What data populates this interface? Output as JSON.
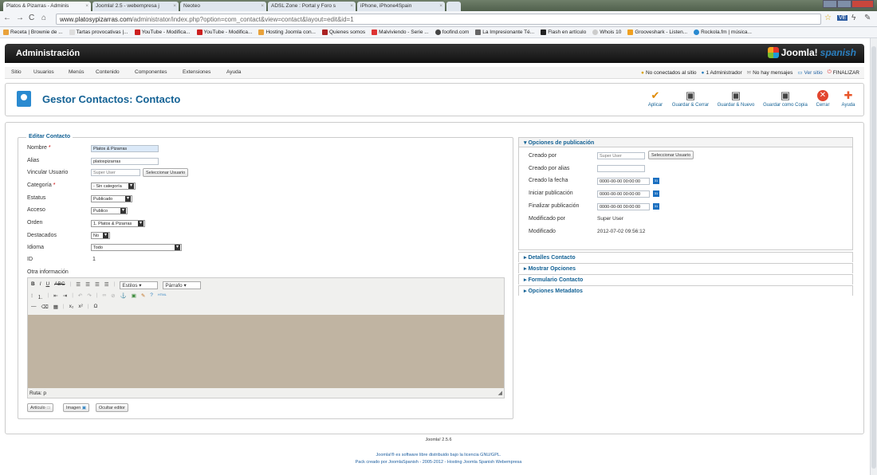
{
  "browser": {
    "tabs": [
      {
        "label": "Platos & Pizarras - Adminis",
        "active": true
      },
      {
        "label": "Joomla! 2.5 - webempresa j"
      },
      {
        "label": "Neoteo"
      },
      {
        "label": "ADSL Zone : Portal y Foro s"
      },
      {
        "label": "iPhone, iPhone4Spain"
      }
    ],
    "url_host": "www.platosypizarras.com",
    "url_path": "/administrator/index.php?option=com_contact&view=contact&layout=edit&id=1",
    "bookmarks": [
      "Receta | Brownie de ...",
      "Tartas provocativas |...",
      "YouTube - Modifica...",
      "YouTube - Modifica...",
      "Hosting Joomla con...",
      "Quienes somos",
      "Malviviendo - Serie ...",
      "foofind.com",
      "La Impresionante Té...",
      "Flash en artículo",
      "Whois 10",
      "Grooveshark - Listen...",
      "Rockola.fm | música..."
    ]
  },
  "admin": {
    "title": "Administración",
    "logo_word": "Joomla!",
    "logo_spanish": "spanish"
  },
  "menu": [
    "Sitio",
    "Usuarios",
    "Menús",
    "Contenido",
    "Componentes",
    "Extensiones",
    "Ayuda"
  ],
  "status": {
    "visitors": "No conectados al sitio",
    "admins": "1 Administrador",
    "messages": "No hay mensajes",
    "view_site": "Ver sitio",
    "logout": "FINALIZAR"
  },
  "page": {
    "title": "Gestor Contactos: Contacto"
  },
  "toolbar": {
    "apply": "Aplicar",
    "save_close": "Guardar & Cerrar",
    "save_new": "Guardar & Nuevo",
    "save_copy": "Guardar como Copia",
    "close": "Cerrar",
    "help": "Ayuda"
  },
  "form": {
    "legend": "Editar Contacto",
    "name_label": "Nombre",
    "name_value": "Platos & Pizarras",
    "alias_label": "Alias",
    "alias_value": "platospizarras",
    "user_label": "Vincular Usuario",
    "user_value": "Super User",
    "select_user": "Seleccionar Usuario",
    "category_label": "Categoría",
    "category_value": "- Sin categoría",
    "status_label": "Estatus",
    "status_value": "Publicado",
    "access_label": "Acceso",
    "access_value": "Publico",
    "order_label": "Orden",
    "order_value": "1. Platos & Pizarras",
    "featured_label": "Destacados",
    "featured_value": "No",
    "language_label": "Idioma",
    "language_value": "Todo",
    "id_label": "ID",
    "id_value": "1",
    "misc_label": "Otra información",
    "required_mark": "*"
  },
  "editor": {
    "styles": "Estilos",
    "format": "Párrafo",
    "path": "Ruta: p",
    "buttons": {
      "article": "Artículo",
      "image": "Imagen",
      "toggle": "Ocultar editor"
    }
  },
  "publishing": {
    "header": "Opciones de publicación",
    "created_by_label": "Creado por",
    "created_by_value": "Super User",
    "select_user": "Seleccionar Usuario",
    "created_alias_label": "Creado por alias",
    "created_alias_value": "",
    "created_date_label": "Creado la fecha",
    "created_date_value": "0000-00-00 00:00:00",
    "publish_up_label": "Iniciar publicación",
    "publish_up_value": "0000-00-00 00:00:00",
    "publish_down_label": "Finalizar publicación",
    "publish_down_value": "0000-00-00 00:00:00",
    "modified_by_label": "Modificado por",
    "modified_by_value": "Super User",
    "modified_label": "Modificado",
    "modified_value": "2012-07-02 09:56:12",
    "calendar_label": "31"
  },
  "panels": [
    "Detalles Contacto",
    "Mostrar Opciones",
    "Formulario Contacto",
    "Opciones Metadatos"
  ],
  "footer": {
    "version": "Joomla! 2.5.6",
    "license": "Joomla!® es software libre distribuido bajo la licencia GNU/GPL.",
    "pack": "Pack creado por JoomlaSpanish - 2005-2012 - Hosting Joomla Spanish Webempresa"
  }
}
